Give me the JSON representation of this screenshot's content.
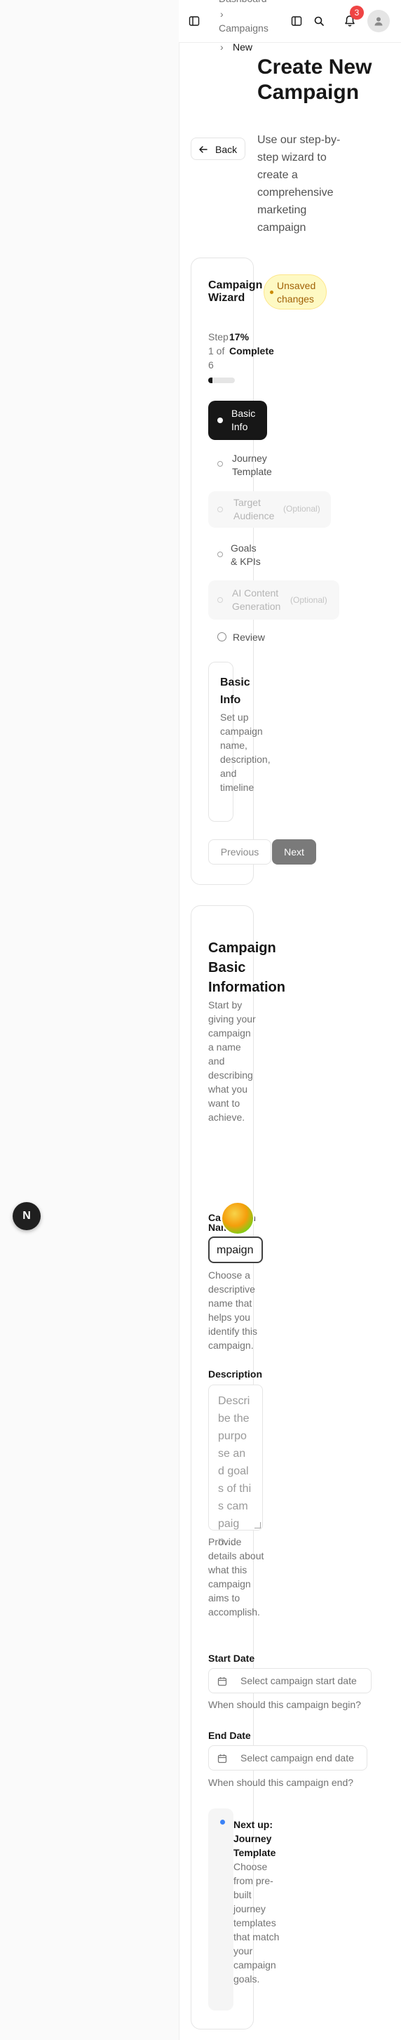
{
  "breadcrumb": {
    "items": [
      "Dashboard",
      "Campaigns",
      "New"
    ]
  },
  "header": {
    "notification_count": "3"
  },
  "page": {
    "title": "Create New Campaign",
    "subtitle": "Use our step-by-step wizard to create a comprehensive marketing campaign",
    "back_label": "Back"
  },
  "wizard": {
    "title": "Campaign Wizard",
    "badge": "Unsaved changes",
    "step_text": "Step 1 of 6",
    "percent": "17%",
    "complete": "Complete",
    "progress_fraction": 0.17,
    "steps": [
      {
        "label": "Basic Info",
        "optional": ""
      },
      {
        "label": "Journey Template",
        "optional": ""
      },
      {
        "label": "Target Audience",
        "optional": "(Optional)"
      },
      {
        "label": "Goals & KPIs",
        "optional": ""
      },
      {
        "label": "AI Content Generation",
        "optional": "(Optional)"
      },
      {
        "label": "Review",
        "optional": ""
      }
    ],
    "current": {
      "title": "Basic Info",
      "description": "Set up campaign name, description, and timeline"
    },
    "previous_label": "Previous",
    "next_label": "Next"
  },
  "form": {
    "title": "Campaign Basic Information",
    "intro": "Start by giving your campaign a name and describing what you want to achieve.",
    "name": {
      "label": "Campaign Name",
      "value": "mpaign",
      "help": "Choose a descriptive name that helps you identify this campaign."
    },
    "description": {
      "label": "Description",
      "placeholder": "Describe the purpose and goals of this campaign...",
      "help": "Provide details about what this campaign aims to accomplish."
    },
    "start_date": {
      "label": "Start Date",
      "placeholder": "Select campaign start date",
      "help": "When should this campaign begin?"
    },
    "end_date": {
      "label": "End Date",
      "placeholder": "Select campaign end date",
      "help": "When should this campaign end?"
    },
    "next_up": {
      "title": "Next up: Journey Template",
      "text": "Choose from pre-built journey templates that match your campaign goals."
    }
  },
  "floating": {
    "dev_badge": "N"
  },
  "colors": {
    "accent": "#171717",
    "notification": "#ef4444",
    "badge_bg": "#fef9c3",
    "badge_text": "#a16207",
    "next_dot": "#3b82f6"
  }
}
